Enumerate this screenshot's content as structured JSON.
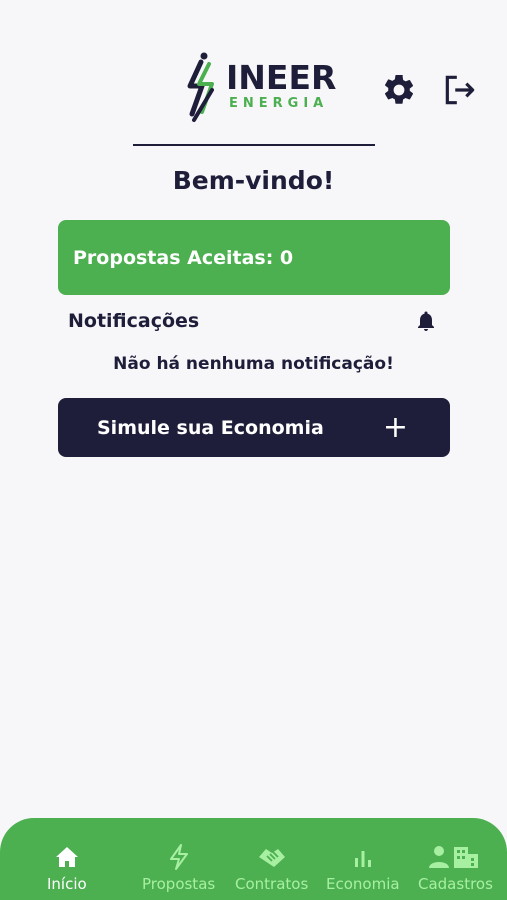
{
  "header": {
    "logo_word": "INEER",
    "logo_sub": "ENERGIA",
    "settings_icon": "gear-icon",
    "logout_icon": "logout-icon"
  },
  "main": {
    "welcome": "Bem-vindo!",
    "accepted_proposals_label": "Propostas Aceitas: 0",
    "notifications_title": "Notificações",
    "notifications_icon": "bell-icon",
    "no_notifications": "Não há nenhuma notificação!",
    "simulate_label": "Simule sua Economia",
    "simulate_icon": "+"
  },
  "bottom_nav": {
    "items": [
      {
        "label": "Início",
        "icon": "home-icon",
        "active": true
      },
      {
        "label": "Propostas",
        "icon": "bolt-icon",
        "active": false
      },
      {
        "label": "Contratos",
        "icon": "handshake-icon",
        "active": false
      },
      {
        "label": "Economia",
        "icon": "bar-chart-icon",
        "active": false
      },
      {
        "label": "Cadastros",
        "icon": "person-building-icon",
        "active": false
      }
    ]
  },
  "colors": {
    "brand_green": "#4caf50",
    "navy": "#1e1e3a",
    "inactive_nav": "#a7f0a1",
    "background": "#f7f7f9"
  }
}
